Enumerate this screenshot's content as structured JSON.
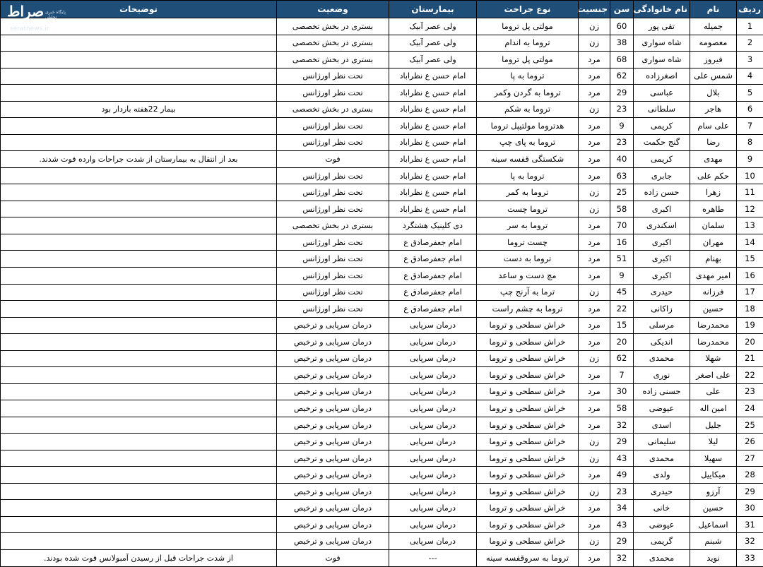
{
  "watermark": {
    "logo": "صراط",
    "url": "seratnews.ir",
    "subtitle": "پایگاه خبری تحلیلی"
  },
  "headers": {
    "row": "ردیف",
    "first": "نام",
    "last": "نام خانوادگی",
    "age": "سن",
    "gender": "جنسیت",
    "surgery": "نوع جراحت",
    "hospital": "بیمارستان",
    "status": "وضعیت",
    "notes": "توضیحات"
  },
  "rows": [
    {
      "row": "1",
      "first": "جمیله",
      "last": "تقی پور",
      "age": "60",
      "gender": "زن",
      "surgery": "مولتی پل تروما",
      "hospital": "ولی عصر آبیک",
      "status": "بستری در بخش تخصصی",
      "notes": ""
    },
    {
      "row": "2",
      "first": "معصومه",
      "last": "شاه سواری",
      "age": "38",
      "gender": "زن",
      "surgery": "تروما به اندام",
      "hospital": "ولی عصر آبیک",
      "status": "بستری در بخش تخصصی",
      "notes": ""
    },
    {
      "row": "3",
      "first": "فیروز",
      "last": "شاه سواری",
      "age": "68",
      "gender": "مرد",
      "surgery": "مولتی پل تروما",
      "hospital": "ولی عصر آبیک",
      "status": "بستری در بخش تخصصی",
      "notes": ""
    },
    {
      "row": "4",
      "first": "شمس علی",
      "last": "اصغرزاده",
      "age": "62",
      "gender": "مرد",
      "surgery": "تروما به پا",
      "hospital": "امام حسن ع نظراباد",
      "status": "تحت نظر اورژانس",
      "notes": ""
    },
    {
      "row": "5",
      "first": "بلال",
      "last": "عباسی",
      "age": "29",
      "gender": "مرد",
      "surgery": "تروما به گردن وکمر",
      "hospital": "امام حسن ع نظراباد",
      "status": "تحت نظر اورژانس",
      "notes": ""
    },
    {
      "row": "6",
      "first": "هاجر",
      "last": "سلطانی",
      "age": "23",
      "gender": "زن",
      "surgery": "تروما به شکم",
      "hospital": "امام حسن ع نظراباد",
      "status": "بستری در بخش تخصصی",
      "notes": "بیمار 22هفته باردار بود"
    },
    {
      "row": "7",
      "first": "علی سام",
      "last": "کریمی",
      "age": "9",
      "gender": "مرد",
      "surgery": "هدتروما مولتیپل تروما",
      "hospital": "امام حسن ع نظراباد",
      "status": "تحت نظر اورژانس",
      "notes": ""
    },
    {
      "row": "8",
      "first": "رضا",
      "last": "گنج حکمت",
      "age": "23",
      "gender": "مرد",
      "surgery": "تروما به پای چپ",
      "hospital": "امام حسن ع نظراباد",
      "status": "تحت نظر اورژانس",
      "notes": ""
    },
    {
      "row": "9",
      "first": "مهدی",
      "last": "کریمی",
      "age": "40",
      "gender": "مرد",
      "surgery": "شکستگی قفسه سینه",
      "hospital": "امام حسن ع نظراباد",
      "status": "فوت",
      "notes": "بعد از انتقال به بیمارستان از شدت جراحات وارده فوت شدند."
    },
    {
      "row": "10",
      "first": "حکم علی",
      "last": "جابری",
      "age": "63",
      "gender": "مرد",
      "surgery": "تروما به پا",
      "hospital": "امام حسن ع نظراباد",
      "status": "تحت نظر اورژانس",
      "notes": ""
    },
    {
      "row": "11",
      "first": "زهرا",
      "last": "حسن زاده",
      "age": "25",
      "gender": "زن",
      "surgery": "تروما به کمر",
      "hospital": "امام حسن ع نظراباد",
      "status": "تحت نظر اورژانس",
      "notes": ""
    },
    {
      "row": "12",
      "first": "طاهره",
      "last": "اکبری",
      "age": "58",
      "gender": "زن",
      "surgery": "تروما چست",
      "hospital": "امام حسن ع نظراباد",
      "status": "تحت نظر اورژانس",
      "notes": ""
    },
    {
      "row": "13",
      "first": "سلمان",
      "last": "اسکندری",
      "age": "70",
      "gender": "مرد",
      "surgery": "تروما به سر",
      "hospital": "دی کلینیک هشتگرد",
      "status": "بستری در بخش تخصصی",
      "notes": ""
    },
    {
      "row": "14",
      "first": "مهران",
      "last": "اکبری",
      "age": "16",
      "gender": "مرد",
      "surgery": "چست تروما",
      "hospital": "امام جعفرصادق ع",
      "status": "تحت نظر اورژانس",
      "notes": ""
    },
    {
      "row": "15",
      "first": "بهنام",
      "last": "اکبری",
      "age": "51",
      "gender": "مرد",
      "surgery": "تروما به دست",
      "hospital": "امام جعفرصادق ع",
      "status": "تحت نظر اورژانس",
      "notes": ""
    },
    {
      "row": "16",
      "first": "امیر مهدی",
      "last": "اکبری",
      "age": "9",
      "gender": "مرد",
      "surgery": "مچ دست و ساعد",
      "hospital": "امام جعفرصادق ع",
      "status": "تحت نظر اورژانس",
      "notes": ""
    },
    {
      "row": "17",
      "first": "فرزانه",
      "last": "حیدری",
      "age": "45",
      "gender": "زن",
      "surgery": "ترما به آرنج چپ",
      "hospital": "امام جعفرصادق ع",
      "status": "تحت نظر اورژانس",
      "notes": ""
    },
    {
      "row": "18",
      "first": "حسین",
      "last": "زاکانی",
      "age": "22",
      "gender": "مرد",
      "surgery": "تروما به چشم راست",
      "hospital": "امام جعفرصادق ع",
      "status": "تحت نظر اورژانس",
      "notes": ""
    },
    {
      "row": "19",
      "first": "محمدرضا",
      "last": "مرسلی",
      "age": "15",
      "gender": "مرد",
      "surgery": "خراش سطحی و تروما",
      "hospital": "درمان سرپایی",
      "status": "درمان سرپایی و ترخیص",
      "notes": ""
    },
    {
      "row": "20",
      "first": "محمدرضا",
      "last": "اندیکی",
      "age": "20",
      "gender": "مرد",
      "surgery": "خراش سطحی و تروما",
      "hospital": "درمان سرپایی",
      "status": "درمان سرپایی و ترخیص",
      "notes": ""
    },
    {
      "row": "21",
      "first": "شهلا",
      "last": "محمدی",
      "age": "62",
      "gender": "زن",
      "surgery": "خراش سطحی و تروما",
      "hospital": "درمان سرپایی",
      "status": "درمان سرپایی و ترخیص",
      "notes": ""
    },
    {
      "row": "22",
      "first": "علی اصغر",
      "last": "نوری",
      "age": "7",
      "gender": "مرد",
      "surgery": "خراش سطحی و تروما",
      "hospital": "درمان سرپایی",
      "status": "درمان سرپایی و ترخیص",
      "notes": ""
    },
    {
      "row": "23",
      "first": "علی",
      "last": "حسنی زاده",
      "age": "30",
      "gender": "مرد",
      "surgery": "خراش سطحی و تروما",
      "hospital": "درمان سرپایی",
      "status": "درمان سرپایی و ترخیص",
      "notes": ""
    },
    {
      "row": "24",
      "first": "امین اله",
      "last": "عیوضی",
      "age": "58",
      "gender": "مرد",
      "surgery": "خراش سطحی و تروما",
      "hospital": "درمان سرپایی",
      "status": "درمان سرپایی و ترخیص",
      "notes": ""
    },
    {
      "row": "25",
      "first": "جلیل",
      "last": "اسدی",
      "age": "32",
      "gender": "مرد",
      "surgery": "خراش سطحی و تروما",
      "hospital": "درمان سرپایی",
      "status": "درمان سرپایی و ترخیص",
      "notes": ""
    },
    {
      "row": "26",
      "first": "لیلا",
      "last": "سلیمانی",
      "age": "29",
      "gender": "زن",
      "surgery": "خراش سطحی و تروما",
      "hospital": "درمان سرپایی",
      "status": "درمان سرپایی و ترخیص",
      "notes": ""
    },
    {
      "row": "27",
      "first": "سهیلا",
      "last": "محمدی",
      "age": "43",
      "gender": "زن",
      "surgery": "خراش سطحی و تروما",
      "hospital": "درمان سرپایی",
      "status": "درمان سرپایی و ترخیص",
      "notes": ""
    },
    {
      "row": "28",
      "first": "میکاییل",
      "last": "ولدی",
      "age": "49",
      "gender": "مرد",
      "surgery": "خراش سطحی و تروما",
      "hospital": "درمان سرپایی",
      "status": "درمان سرپایی و ترخیص",
      "notes": ""
    },
    {
      "row": "29",
      "first": "آرزو",
      "last": "حیدری",
      "age": "23",
      "gender": "زن",
      "surgery": "خراش سطحی و تروما",
      "hospital": "درمان سرپایی",
      "status": "درمان سرپایی و ترخیص",
      "notes": ""
    },
    {
      "row": "30",
      "first": "حسین",
      "last": "خانی",
      "age": "34",
      "gender": "مرد",
      "surgery": "خراش سطحی و تروما",
      "hospital": "درمان سرپایی",
      "status": "درمان سرپایی و ترخیص",
      "notes": ""
    },
    {
      "row": "31",
      "first": "اسماعیل",
      "last": "عیوضی",
      "age": "43",
      "gender": "مرد",
      "surgery": "خراش سطحی و تروما",
      "hospital": "درمان سرپایی",
      "status": "درمان سرپایی و ترخیص",
      "notes": ""
    },
    {
      "row": "32",
      "first": "شبنم",
      "last": "گریمی",
      "age": "29",
      "gender": "زن",
      "surgery": "خراش سطحی و تروما",
      "hospital": "درمان سرپایی",
      "status": "درمان سرپایی و ترخیص",
      "notes": ""
    },
    {
      "row": "33",
      "first": "نوید",
      "last": "محمدی",
      "age": "32",
      "gender": "مرد",
      "surgery": "تروما به سروقفسه سینه",
      "hospital": "---",
      "status": "فوت",
      "notes": "از شدت جراحات قبل از رسیدن آمبولانس فوت شده بودند."
    }
  ]
}
